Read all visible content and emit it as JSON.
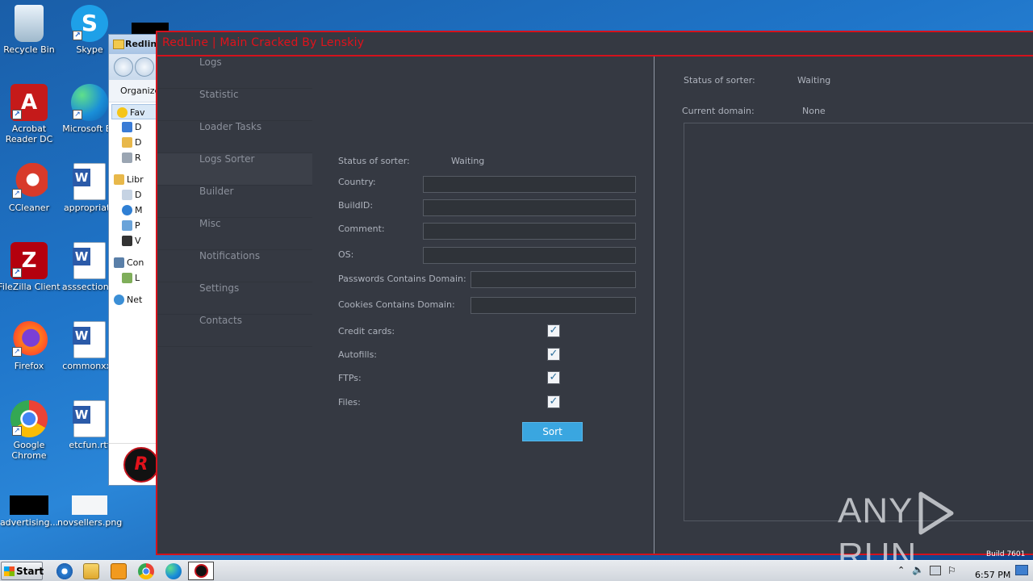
{
  "desktop": {
    "icons": [
      {
        "label": "Recycle Bin"
      },
      {
        "label": "Skype"
      },
      {
        "label": "Acrobat Reader DC"
      },
      {
        "label": "Microsoft Ed"
      },
      {
        "label": "CCleaner"
      },
      {
        "label": "appropriate"
      },
      {
        "label": "FileZilla Client"
      },
      {
        "label": "asssection..."
      },
      {
        "label": "Firefox"
      },
      {
        "label": "commonxxx"
      },
      {
        "label": "Google Chrome"
      },
      {
        "label": "etcfun.rtf"
      },
      {
        "label": "advertising..."
      },
      {
        "label": "novsellers.png"
      }
    ]
  },
  "explorer": {
    "title": "Redline",
    "organize": "Organize",
    "tree": [
      "Fav",
      "D",
      "D",
      "R",
      "Libr",
      "D",
      "M",
      "P",
      "V",
      "Con",
      "L",
      "Net"
    ]
  },
  "app": {
    "title": "RedLine | Main Cracked By Lenskiy",
    "accent_color": "#d4121c",
    "sidebar": [
      {
        "label": "Logs"
      },
      {
        "label": "Statistic"
      },
      {
        "label": "Loader Tasks"
      },
      {
        "label": "Logs Sorter",
        "active": true
      },
      {
        "label": "Builder"
      },
      {
        "label": "Misc"
      },
      {
        "label": "Notifications"
      },
      {
        "label": "Settings"
      },
      {
        "label": "Contacts"
      }
    ],
    "sorter": {
      "status_label": "Status of sorter:",
      "status_value": "Waiting",
      "country_label": "Country:",
      "country_value": "",
      "buildid_label": "BuildID:",
      "buildid_value": "",
      "comment_label": "Comment:",
      "comment_value": "",
      "os_label": "OS:",
      "os_value": "",
      "passwords_label": "Passwords Contains Domain:",
      "passwords_value": "",
      "cookies_label": "Cookies Contains Domain:",
      "cookies_value": "",
      "checkboxes": [
        {
          "label": "Credit cards:",
          "checked": true
        },
        {
          "label": "Autofills:",
          "checked": true
        },
        {
          "label": "FTPs:",
          "checked": true
        },
        {
          "label": "Files:",
          "checked": true
        }
      ],
      "sort_button": "Sort"
    },
    "right_panel": {
      "status_label": "Status of sorter:",
      "status_value": "Waiting",
      "domain_label": "Current domain:",
      "domain_value": "None"
    }
  },
  "watermark": {
    "left": "ANY",
    "right": "RUN"
  },
  "build_text": "Build 7601",
  "taskbar": {
    "start_label": "Start",
    "clock": "6:57 PM"
  }
}
